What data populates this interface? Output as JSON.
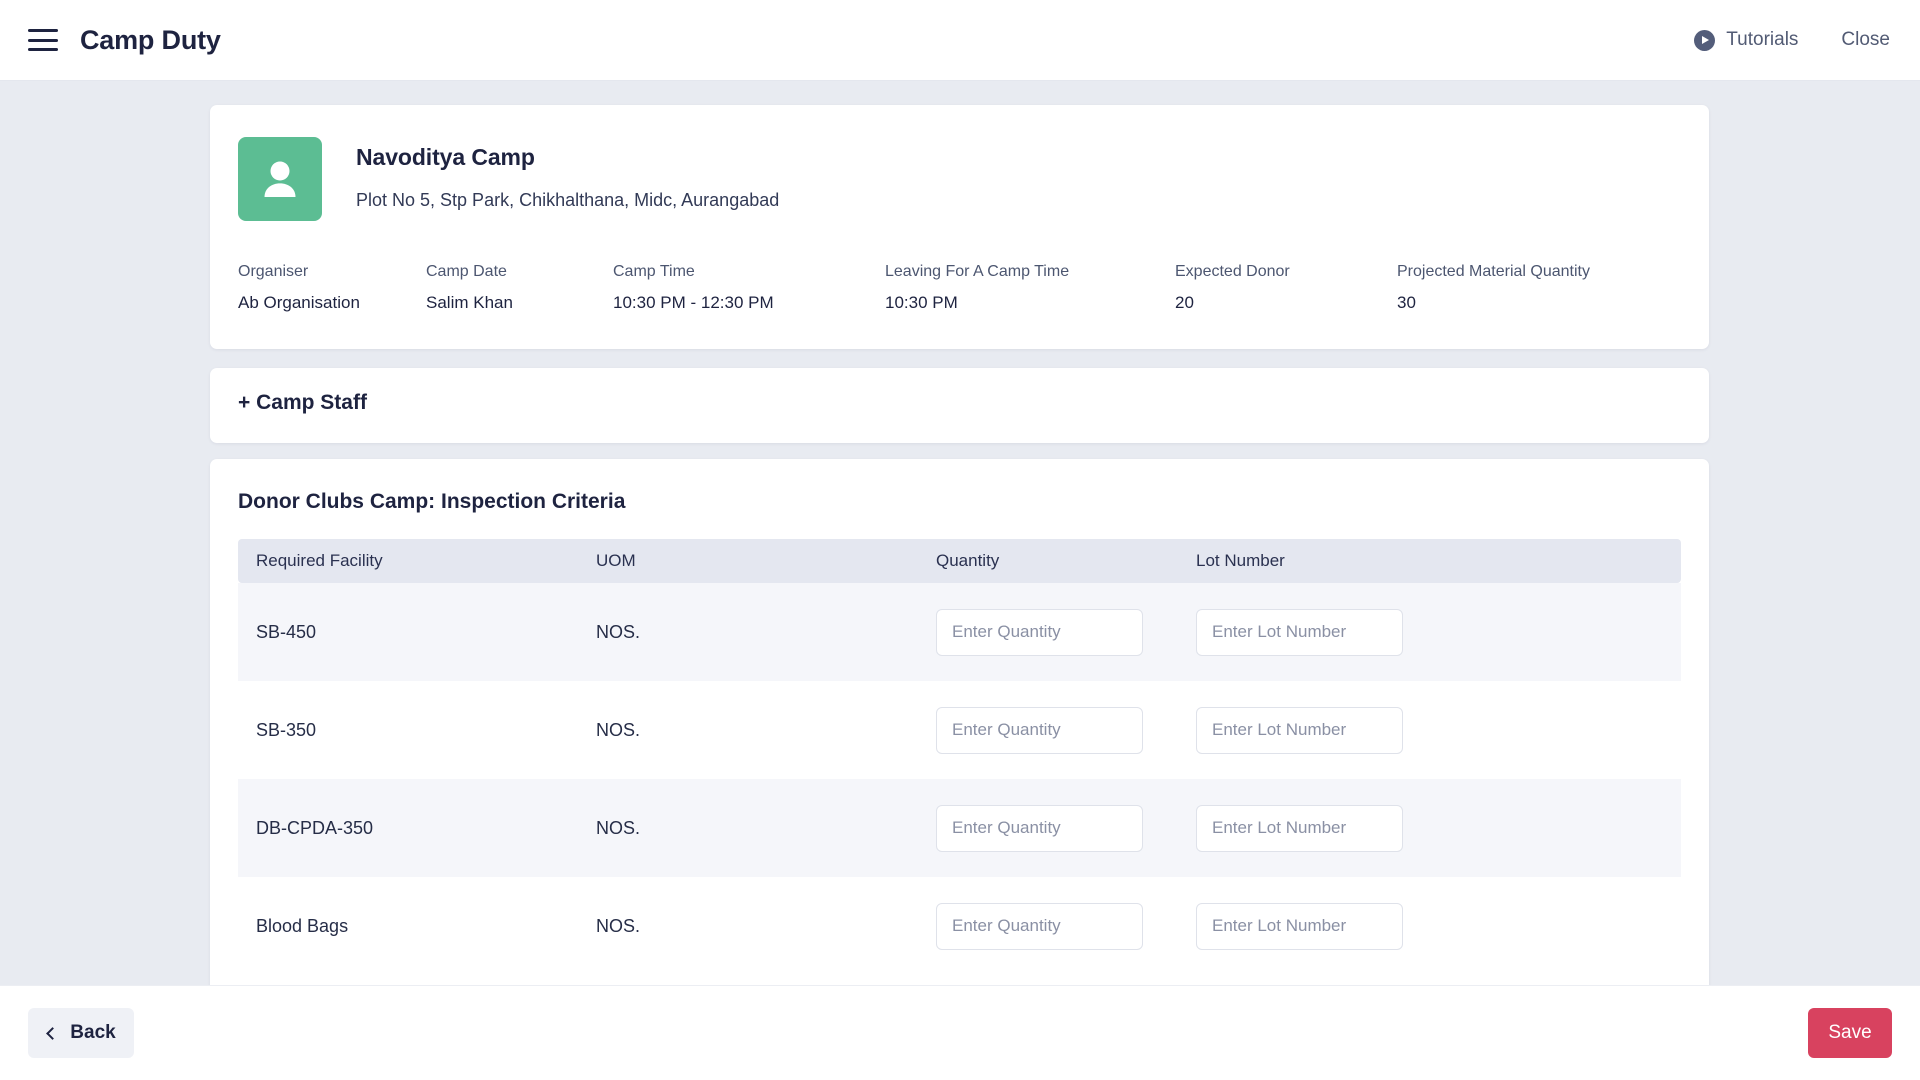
{
  "topbar": {
    "menu_icon": "hamburger-menu-icon",
    "title": "Camp Duty",
    "tutorials_label": "Tutorials",
    "tutorials_icon": "play-circle-icon",
    "close_label": "Close"
  },
  "camp": {
    "avatar_icon": "person-avatar-icon",
    "avatar_color": "#5cbd93",
    "name": "Navoditya Camp",
    "address": "Plot No 5, Stp Park, Chikhalthana, Midc, Aurangabad",
    "meta": [
      {
        "label": "Organiser",
        "value": "Ab Organisation"
      },
      {
        "label": "Camp Date",
        "value": "Salim Khan"
      },
      {
        "label": "Camp Time",
        "value": "10:30 PM - 12:30 PM"
      },
      {
        "label": "Leaving For A Camp Time",
        "value": "10:30 PM"
      },
      {
        "label": "Expected Donor",
        "value": "20"
      },
      {
        "label": "Projected Material Quantity",
        "value": "30"
      }
    ]
  },
  "camp_staff": {
    "label": "+ Camp Staff"
  },
  "inspection": {
    "title": "Donor Clubs Camp: Inspection Criteria",
    "columns": [
      "Required Facility",
      "UOM",
      "Quantity",
      "Lot Number"
    ],
    "rows": [
      {
        "facility": "SB-450",
        "uom": "NOS.",
        "quantity_value": "",
        "quantity_placeholder": "Enter Quantity",
        "lot_value": "",
        "lot_placeholder": "Enter Lot Number"
      },
      {
        "facility": "SB-350",
        "uom": "NOS.",
        "quantity_value": "",
        "quantity_placeholder": "Enter Quantity",
        "lot_value": "",
        "lot_placeholder": "Enter Lot Number"
      },
      {
        "facility": "DB-CPDA-350",
        "uom": "NOS.",
        "quantity_value": "",
        "quantity_placeholder": "Enter Quantity",
        "lot_value": "",
        "lot_placeholder": "Enter Lot Number"
      },
      {
        "facility": "Blood Bags",
        "uom": "NOS.",
        "quantity_value": "",
        "quantity_placeholder": "Enter Quantity",
        "lot_value": "",
        "lot_placeholder": "Enter Lot Number"
      }
    ]
  },
  "footer": {
    "back_label": "Back",
    "back_icon": "chevron-left-icon",
    "save_label": "Save",
    "save_color": "#d8425f"
  }
}
